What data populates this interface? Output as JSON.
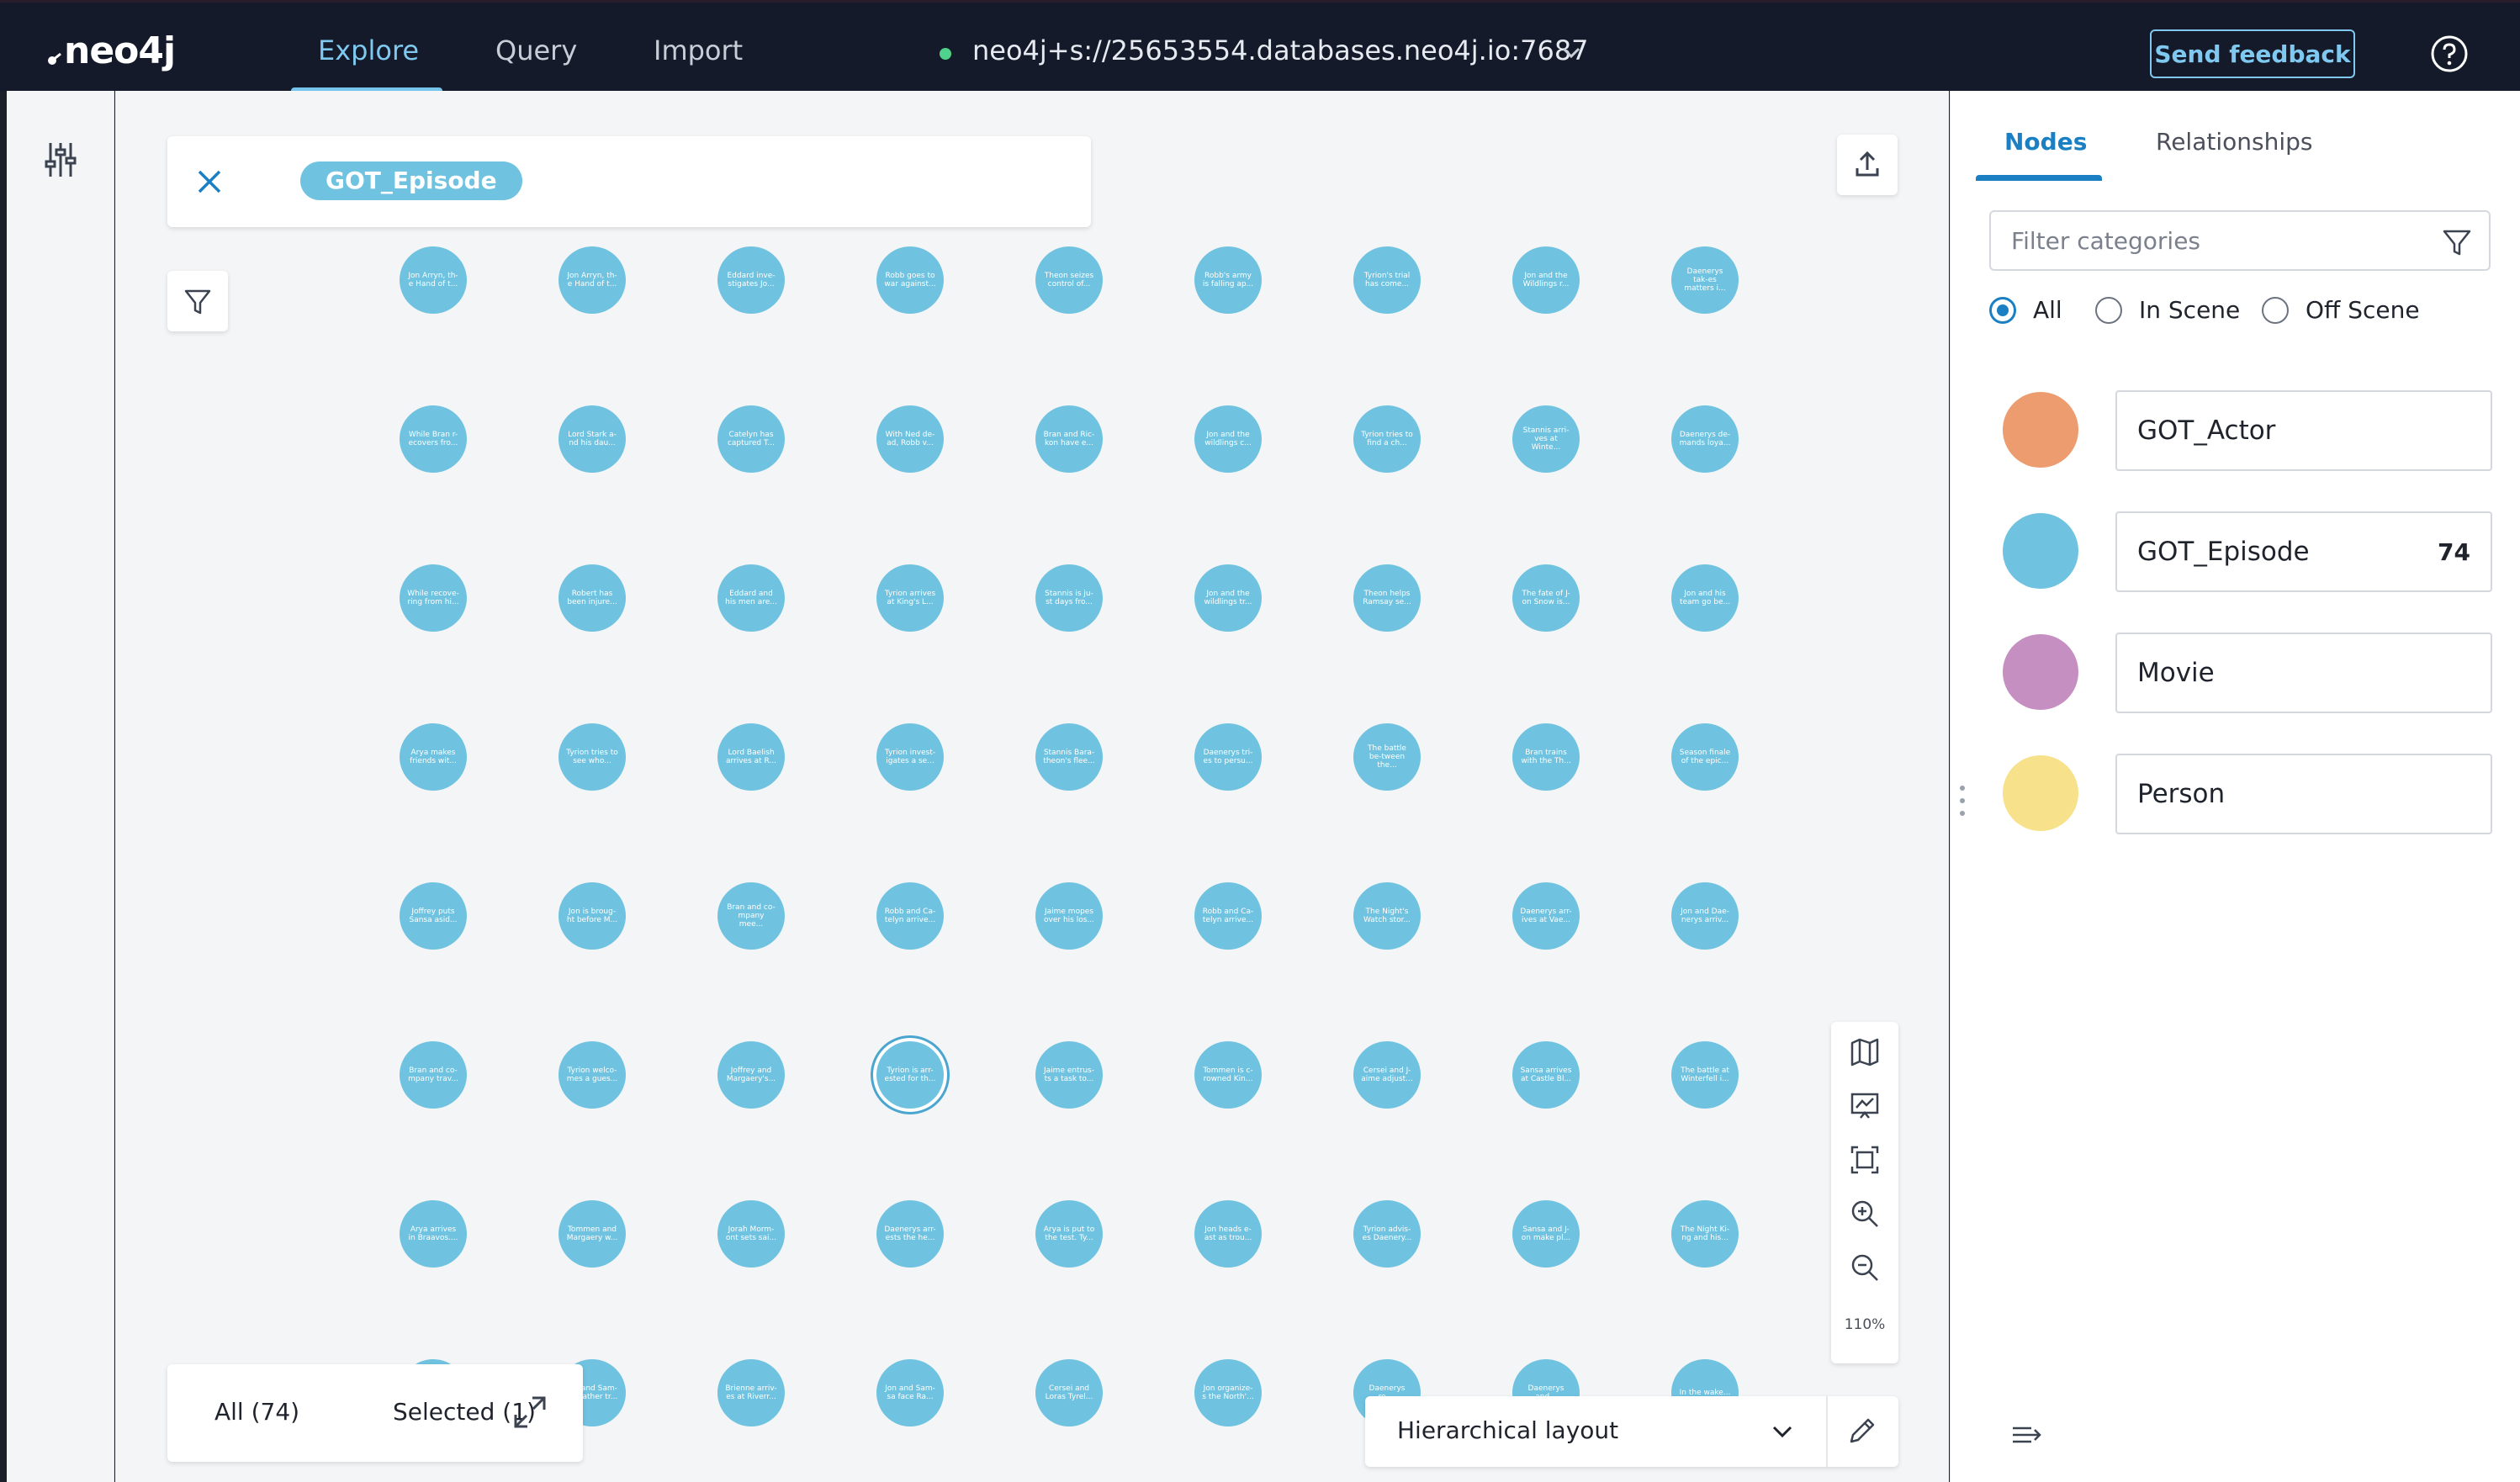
{
  "app": {
    "logo": "neo4j"
  },
  "nav": {
    "tabs": [
      {
        "label": "Explore",
        "active": true
      },
      {
        "label": "Query",
        "active": false
      },
      {
        "label": "Import",
        "active": false
      }
    ],
    "connection": {
      "uri": "neo4j+s://25653554.databases.neo4j.io:7687",
      "status_color": "#4fd18b"
    },
    "feedback_label": "Send feedback",
    "help_icon": "help-circle-icon"
  },
  "search": {
    "chip_label": "GOT_Episode",
    "chip_color": "#6fc3e0"
  },
  "graph": {
    "node_color": "#6fc3e0",
    "nodes": [
      [
        "Jon Arryn, th-e Hand of t...",
        "Jon Arryn, th-e Hand of t...",
        "Eddard inve-stigates Jo...",
        "Robb goes to war against...",
        "Theon seizes control of...",
        "Robb's army is falling ap...",
        "Tyrion's trial has come...",
        "Jon and the Wildlings r...",
        "Daenerys tak-es matters i..."
      ],
      [
        "While Bran r-ecovers fro...",
        "Lord Stark a-nd his dau...",
        "Catelyn has captured T...",
        "With Ned de-ad, Robb v...",
        "Bran and Ric-kon have e...",
        "Jon and the wildlings c...",
        "Tyrion tries to find a ch...",
        "Stannis arri-ves at Winte...",
        "Daenerys de-mands loya..."
      ],
      [
        "While recove-ring from hi...",
        "Robert has been injure...",
        "Eddard and his men are...",
        "Tyrion arrives at King's L...",
        "Stannis is ju-st days fro...",
        "Jon and the wildlings tr...",
        "Theon helps Ramsay se...",
        "The fate of J-on Snow is...",
        "Jon and his team go be..."
      ],
      [
        "Arya makes friends wit...",
        "Tyrion tries to see who...",
        "Lord Baelish arrives at R...",
        "Tyrion invest-igates a se...",
        "Stannis Bara-theon's flee...",
        "Daenerys tri-es to persu...",
        "The battle be-tween the...",
        "Bran trains with the Th...",
        "Season finale of the epic..."
      ],
      [
        "Joffrey puts Sansa asid...",
        "Jon is broug-ht before M...",
        "Bran and co-mpany mee...",
        "Robb and Ca-telyn arrive...",
        "Jaime mopes over his los...",
        "Robb and Ca-telyn arrive...",
        "The Night's Watch stor...",
        "Daenerys arr-ives at Vae...",
        "Jon and Dae-nerys arriv..."
      ],
      [
        "Bran and co-mpany trav...",
        "Tyrion welco-mes a gues...",
        "Joffrey and Margaery's...",
        "Tyrion is arr-ested for th...",
        "Jaime entrus-ts a task to...",
        "Tommen is c-rowned Kin...",
        "Cersei and J-aime adjust...",
        "Sansa arrives at Castle Bl...",
        "The battle at Winterfell i..."
      ],
      [
        "Arya arrives in Braavos....",
        "Tommen and Margaery w...",
        "Jorah Morm-ont sets sai...",
        "Daenerys arr-ests the he...",
        "Arya is put to the test. Ty...",
        "Jon heads e-ast as trou...",
        "Tyrion advis-es Daenery...",
        "Sansa and J-on make pl...",
        "The Night Ki-ng and his..."
      ],
      [
        "",
        "Jon and Sam-sa gather tr...",
        "Brienne arriv-es at Riverr...",
        "Jon and Sam-sa face Ra...",
        "Cersei and Loras Tyrel...",
        "Jon organize-s the North'...",
        "Daenerys re-...",
        "Daenerys and...",
        "In the wake..."
      ]
    ],
    "selected_node": "Tyrion is arr-ested for th..."
  },
  "view_controls": {
    "icons": [
      "map-icon",
      "presentation-icon",
      "fit-screen-icon",
      "zoom-in-icon",
      "zoom-out-icon"
    ],
    "zoom_label": "110%"
  },
  "counts": {
    "all_label": "All (74)",
    "selected_label": "Selected (1)"
  },
  "layout": {
    "selected": "Hierarchical layout"
  },
  "right_panel": {
    "tabs": [
      {
        "label": "Nodes",
        "active": true
      },
      {
        "label": "Relationships",
        "active": false
      }
    ],
    "filter_placeholder": "Filter categories",
    "radio": [
      {
        "label": "All",
        "checked": true
      },
      {
        "label": "In Scene",
        "checked": false
      },
      {
        "label": "Off Scene",
        "checked": false
      }
    ],
    "categories": [
      {
        "name": "GOT_Actor",
        "count": "",
        "color": "#ec9c6e"
      },
      {
        "name": "GOT_Episode",
        "count": "74",
        "color": "#6fc3e0"
      },
      {
        "name": "Movie",
        "count": "",
        "color": "#c68fc2"
      },
      {
        "name": "Person",
        "count": "",
        "color": "#f7e18b"
      }
    ]
  }
}
